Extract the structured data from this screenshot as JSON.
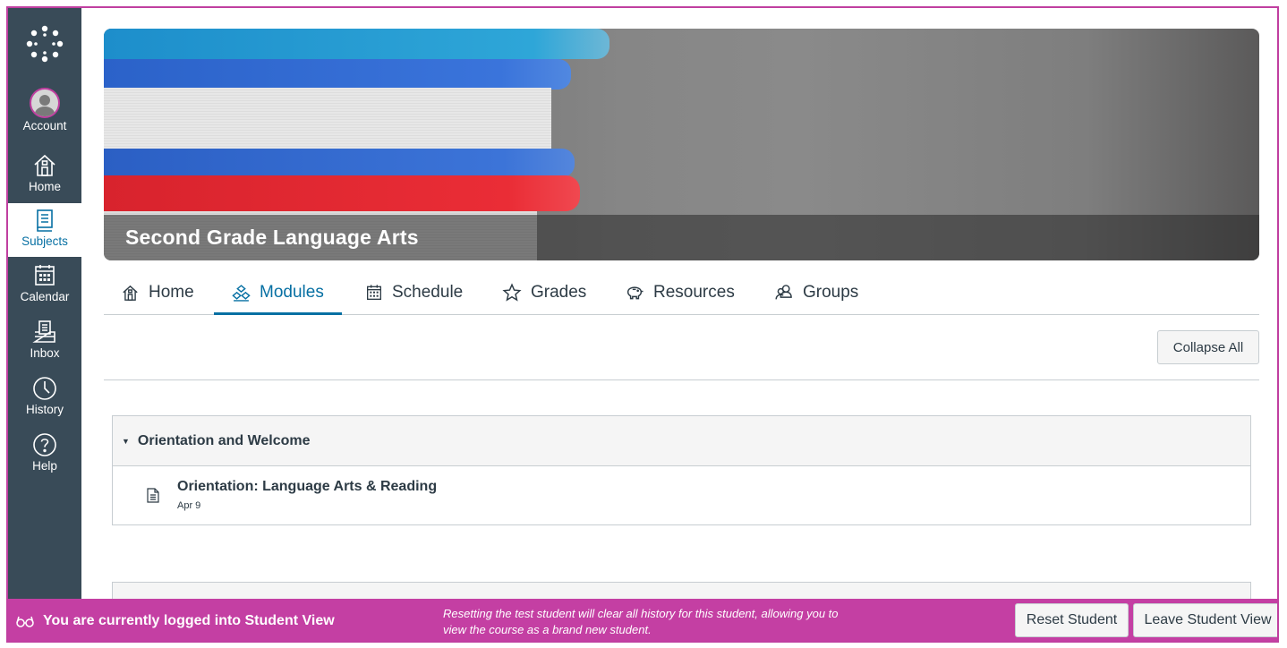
{
  "nav": {
    "account": "Account",
    "home": "Home",
    "subjects": "Subjects",
    "calendar": "Calendar",
    "inbox": "Inbox",
    "history": "History",
    "help": "Help"
  },
  "course": {
    "title": "Second Grade Language Arts"
  },
  "tabs": {
    "home": "Home",
    "modules": "Modules",
    "schedule": "Schedule",
    "grades": "Grades",
    "resources": "Resources",
    "groups": "Groups"
  },
  "toolbar": {
    "collapse_all": "Collapse All"
  },
  "modules": [
    {
      "title": "Orientation and Welcome",
      "items": [
        {
          "title": "Orientation: Language Arts & Reading",
          "date": "Apr 9"
        }
      ]
    }
  ],
  "student_view": {
    "status": "You are currently logged into Student View",
    "reset_note": "Resetting the test student will clear all history for this student, allowing you to view the course as a brand new student.",
    "reset_button": "Reset Student",
    "leave_button": "Leave Student View"
  },
  "colors": {
    "nav_bg": "#394b58",
    "accent": "#0770a3",
    "student_bar": "#c43fa3"
  }
}
